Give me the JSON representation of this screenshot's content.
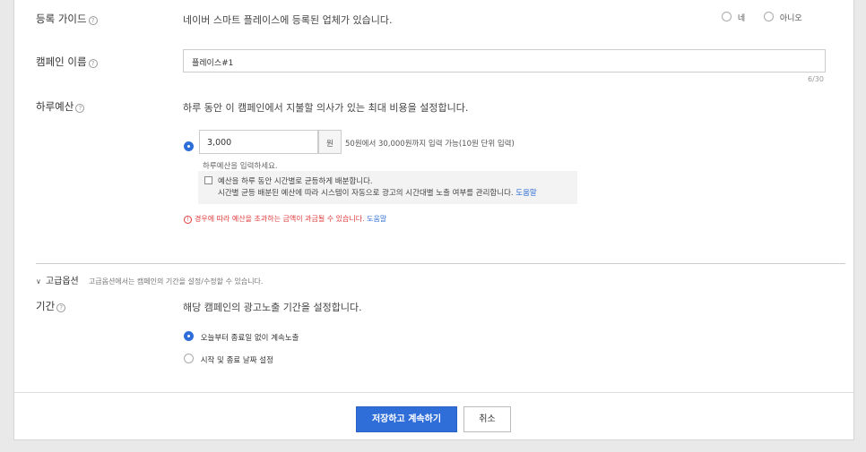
{
  "registration_guide": {
    "label": "등록 가이드",
    "description": "네이버 스마트 플레이스에 등록된 업체가 있습니다.",
    "option_yes": "네",
    "option_no": "아니오"
  },
  "campaign_name": {
    "label": "캠페인 이름",
    "value": "플레이스#1",
    "counter": "6/30"
  },
  "daily_budget": {
    "label": "하루예산",
    "description": "하루 동안 이 캠페인에서 지불할 의사가 있는 최대 비용을 설정합니다.",
    "value": "3,000",
    "unit": "원",
    "range_hint": "50원에서 30,000원까지 입력 가능(10원 단위 입력)",
    "input_hint": "하루예산을 입력하세요.",
    "distribute_label": "예산을 하루 동안 시간별로 균등하게 배분합니다.",
    "distribute_desc": "시간별 균등 배분된 예산에 따라 시스템이 자동으로 광고의 시간대별 노출 여부를 관리합니다.",
    "help_link": "도움말",
    "warning": "경우에 따라 예산을 초과하는 금액이 과금될 수 있습니다.",
    "warning_link": "도움말"
  },
  "advanced": {
    "title": "고급옵션",
    "description": "고급옵션에서는 캠페인의 기간을 설정/수정할 수 있습니다."
  },
  "period": {
    "label": "기간",
    "description": "해당 캠페인의 광고노출 기간을 설정합니다.",
    "option_continuous": "오늘부터 종료일 없이 계속노출",
    "option_dates": "시작 및 종료 날짜 설정"
  },
  "footer": {
    "save_label": "저장하고 계속하기",
    "cancel_label": "취소"
  },
  "colors": {
    "accent": "#2f6ed8",
    "warning": "#e03c3c"
  }
}
